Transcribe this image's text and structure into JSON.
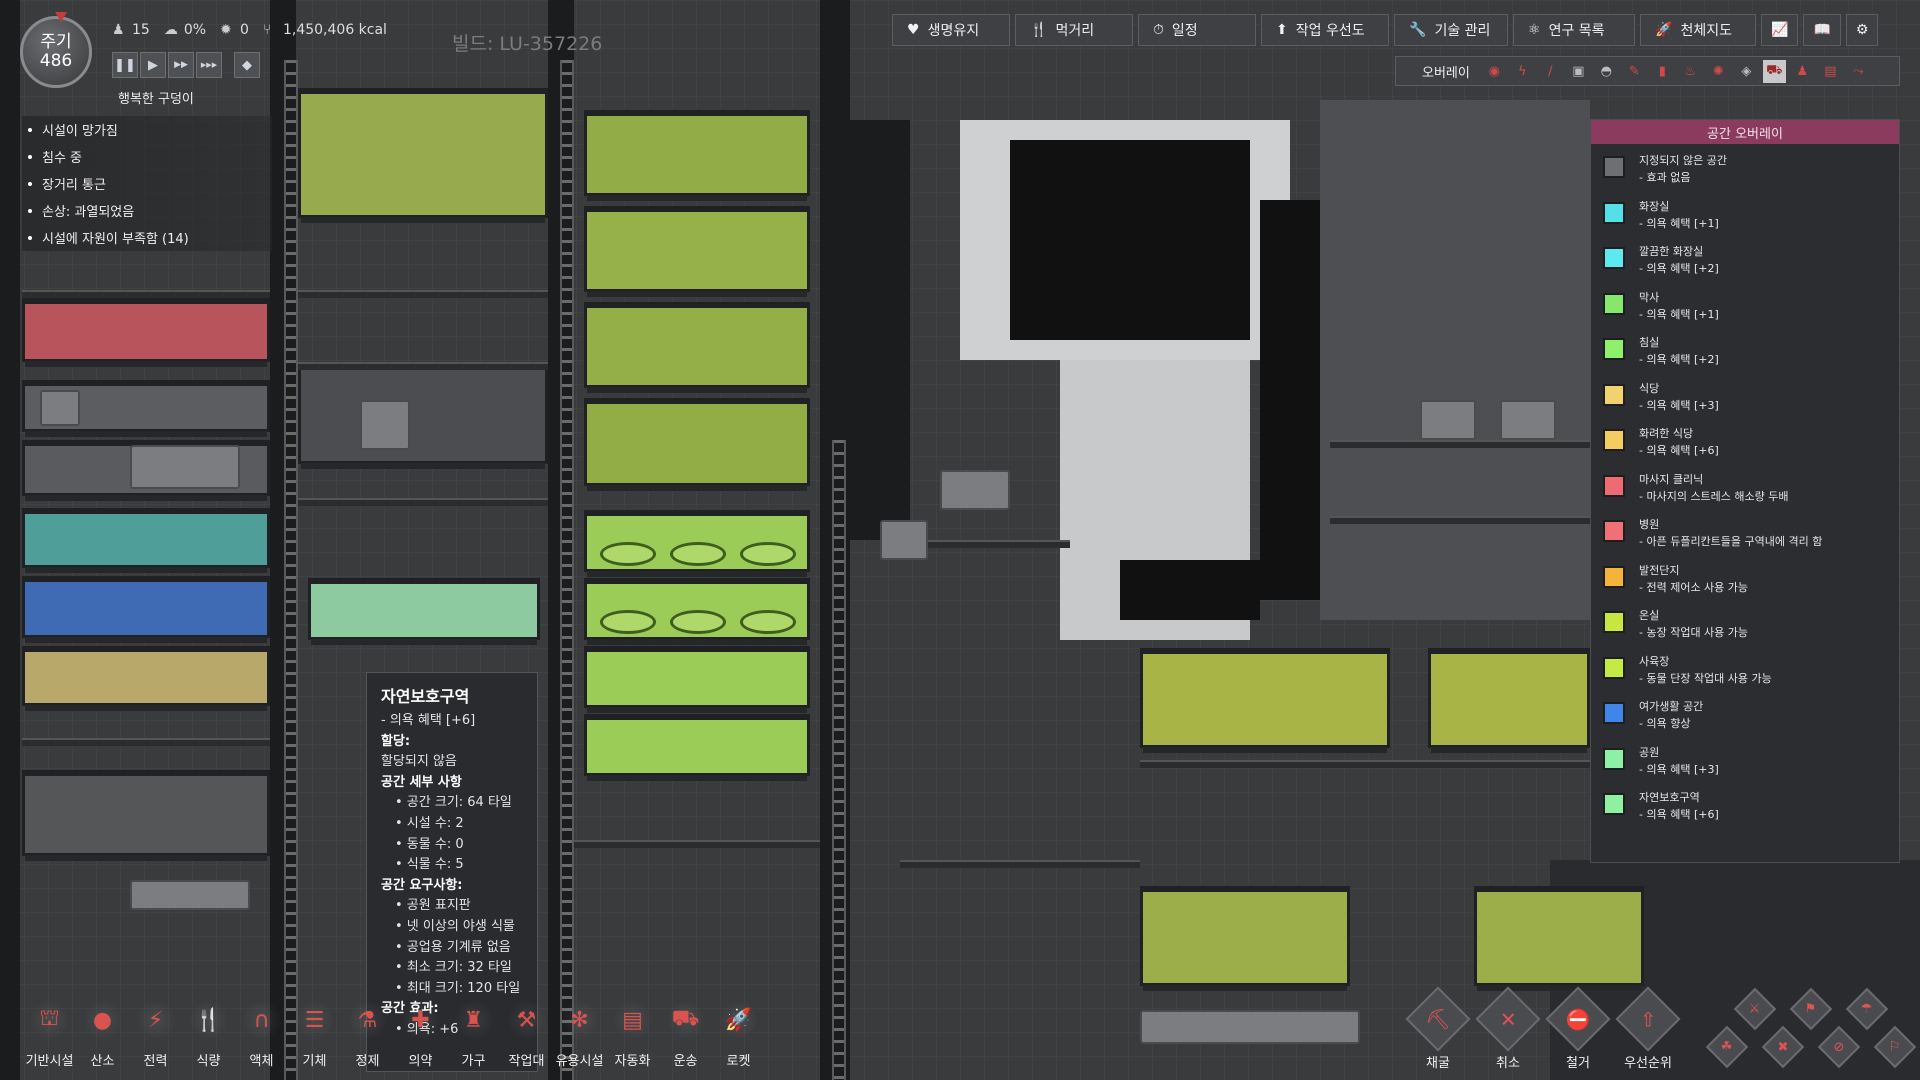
{
  "hud": {
    "cycle_label": "주기",
    "cycle_number": "486",
    "duplicants": "15",
    "stress": "0%",
    "sick": "0",
    "calories": "1,450,406 kcal",
    "mood": "행복한 구덩이",
    "build": "빌드: LU-357226"
  },
  "speed_controls": [
    {
      "name": "pause",
      "glyph": "❚❚"
    },
    {
      "name": "speed-1",
      "glyph": "▶"
    },
    {
      "name": "speed-2",
      "glyph": "▶▶"
    },
    {
      "name": "speed-3",
      "glyph": "▶▶▶"
    },
    {
      "name": "red-alert",
      "glyph": "◆"
    }
  ],
  "alerts": [
    "시설이 망가짐",
    "침수 중",
    "장거리 통근",
    "손상: 과열되었음",
    "시설에 자원이 부족함 (14)"
  ],
  "top_tabs": [
    {
      "name": "vitals",
      "label": "생명유지",
      "icon": "heart-icon",
      "glyph": "♥"
    },
    {
      "name": "consumables",
      "label": "먹거리",
      "icon": "fork-knife-icon",
      "glyph": "🍴"
    },
    {
      "name": "schedule",
      "label": "일정",
      "icon": "clock-icon",
      "glyph": "⏱"
    },
    {
      "name": "priorities",
      "label": "작업 우선도",
      "icon": "stack-icon",
      "glyph": "⬆"
    },
    {
      "name": "skills",
      "label": "기술 관리",
      "icon": "wrench-icon",
      "glyph": "🔧"
    },
    {
      "name": "research",
      "label": "연구 목록",
      "icon": "atom-icon",
      "glyph": "⚛"
    },
    {
      "name": "starmap",
      "label": "천체지도",
      "icon": "rocket-icon",
      "glyph": "🚀"
    }
  ],
  "top_icon_tabs": [
    {
      "name": "report",
      "icon": "chart-icon",
      "glyph": "📈"
    },
    {
      "name": "codex",
      "icon": "book-icon",
      "glyph": "📖"
    },
    {
      "name": "settings",
      "icon": "gear-icon",
      "glyph": "⚙"
    }
  ],
  "overlay_bar": {
    "title": "오버레이",
    "icons": [
      "oxygen-icon",
      "power-icon",
      "temperature-icon",
      "materials-icon",
      "light-icon",
      "decor-icon",
      "plumbing-icon",
      "germ-icon",
      "farming-icon",
      "room-icon",
      "exosuit-icon",
      "automation-icon",
      "conveyor-icon"
    ],
    "active_index": 10
  },
  "legend": {
    "title": "공간 오버레이",
    "items": [
      {
        "name": "지정되지 않은 공간",
        "desc": "- 효과 없음",
        "color": "#6e6f72"
      },
      {
        "name": "화장실",
        "desc": "- 의욕 혜택 [+1]",
        "color": "#55e0e8"
      },
      {
        "name": "깔끔한 화장실",
        "desc": "- 의욕 혜택 [+2]",
        "color": "#5ceaf0"
      },
      {
        "name": "막사",
        "desc": "- 의욕 혜택 [+1]",
        "color": "#86e86a"
      },
      {
        "name": "침실",
        "desc": "- 의욕 혜택 [+2]",
        "color": "#8ff06a"
      },
      {
        "name": "식당",
        "desc": "- 의욕 혜택 [+3]",
        "color": "#f2d26e"
      },
      {
        "name": "화려한 식당",
        "desc": "- 의욕 혜택 [+6]",
        "color": "#f4cc60"
      },
      {
        "name": "마사지 클리닉",
        "desc": "- 마사지의 스트레스 해소량 두배",
        "color": "#ef6b74"
      },
      {
        "name": "병원",
        "desc": "- 아픈 듀플리칸트들을 구역내에 격리 함",
        "color": "#f07078"
      },
      {
        "name": "발전단지",
        "desc": "- 전력 제어소 사용 가능",
        "color": "#f4b43c"
      },
      {
        "name": "온실",
        "desc": "- 농장 작업대 사용 가능",
        "color": "#c8e640"
      },
      {
        "name": "사육장",
        "desc": "- 동물 단장 작업대 사용 가능",
        "color": "#c4ea44"
      },
      {
        "name": "여가생활 공간",
        "desc": "- 의욕 향상",
        "color": "#3f86e8"
      },
      {
        "name": "공원",
        "desc": "- 의욕 혜택 [+3]",
        "color": "#8ef0a4"
      },
      {
        "name": "자연보호구역",
        "desc": "- 의욕 혜택 [+6]",
        "color": "#8ef0a0"
      }
    ]
  },
  "tooltip": {
    "title": "자연보호구역",
    "subtitle": "- 의욕 혜택 [+6]",
    "assign_header": "할당:",
    "assign_value": "할당되지 않음",
    "details_header": "공간 세부 사항",
    "details": [
      "공간 크기: 64 타일",
      "시설 수: 2",
      "동물 수: 0",
      "식물 수: 5"
    ],
    "req_header": "공간 요구사항:",
    "requirements": [
      "공원 표지판",
      "넷 이상의 야생 식물",
      "공업용 기계류 없음",
      "최소 크기: 32 타일",
      "최대 크기: 120 타일"
    ],
    "effect_header": "공간 효과:",
    "effects": [
      "의욕: +6"
    ]
  },
  "build_menu": [
    {
      "name": "base",
      "label": "기반시설",
      "icon": "ladder-icon",
      "glyph": "⛫"
    },
    {
      "name": "oxygen",
      "label": "산소",
      "icon": "bubbles-icon",
      "glyph": "●"
    },
    {
      "name": "power",
      "label": "전력",
      "icon": "generator-icon",
      "glyph": "⚡"
    },
    {
      "name": "food",
      "label": "식량",
      "icon": "fork-knife-icon",
      "glyph": "🍴"
    },
    {
      "name": "plumbing",
      "label": "액체",
      "icon": "pipe-icon",
      "glyph": "∩"
    },
    {
      "name": "ventilation",
      "label": "기체",
      "icon": "vent-icon",
      "glyph": "☰"
    },
    {
      "name": "refining",
      "label": "정제",
      "icon": "refinery-icon",
      "glyph": "⚗"
    },
    {
      "name": "medicine",
      "label": "의약",
      "icon": "medical-icon",
      "glyph": "✚"
    },
    {
      "name": "furniture",
      "label": "가구",
      "icon": "lamp-icon",
      "glyph": "♜"
    },
    {
      "name": "stations",
      "label": "작업대",
      "icon": "station-icon",
      "glyph": "⚒"
    },
    {
      "name": "utilities",
      "label": "유용시설",
      "icon": "fan-icon",
      "glyph": "✻"
    },
    {
      "name": "automation",
      "label": "자동화",
      "icon": "automation-icon",
      "glyph": "▤"
    },
    {
      "name": "shipping",
      "label": "운송",
      "icon": "conveyor-icon",
      "glyph": "⛟"
    },
    {
      "name": "rocketry",
      "label": "로켓",
      "icon": "rocket-icon",
      "glyph": "🚀"
    }
  ],
  "tools": [
    {
      "name": "dig",
      "label": "채굴",
      "icon": "shovel-icon",
      "glyph": "⛏"
    },
    {
      "name": "cancel",
      "label": "취소",
      "icon": "x-icon",
      "glyph": "✕"
    },
    {
      "name": "deconstruct",
      "label": "철거",
      "icon": "deconstruct-icon",
      "glyph": "⛔"
    },
    {
      "name": "priority",
      "label": "우선순위",
      "icon": "priority-arrow-icon",
      "glyph": "⇧"
    }
  ],
  "mini_tools": [
    {
      "name": "attack",
      "icon": "attack-icon",
      "glyph": "⚔"
    },
    {
      "name": "capture",
      "icon": "capture-icon",
      "glyph": "⚑"
    },
    {
      "name": "clean",
      "icon": "mop-icon",
      "glyph": "☂"
    },
    {
      "name": "harvest",
      "icon": "harvest-icon",
      "glyph": "☘"
    },
    {
      "name": "sweep",
      "icon": "broom-icon",
      "glyph": "✖"
    },
    {
      "name": "empty-pipe",
      "icon": "pipe-empty-icon",
      "glyph": "⊘"
    },
    {
      "name": "disconnect",
      "icon": "disconnect-icon",
      "glyph": "⚐"
    }
  ]
}
